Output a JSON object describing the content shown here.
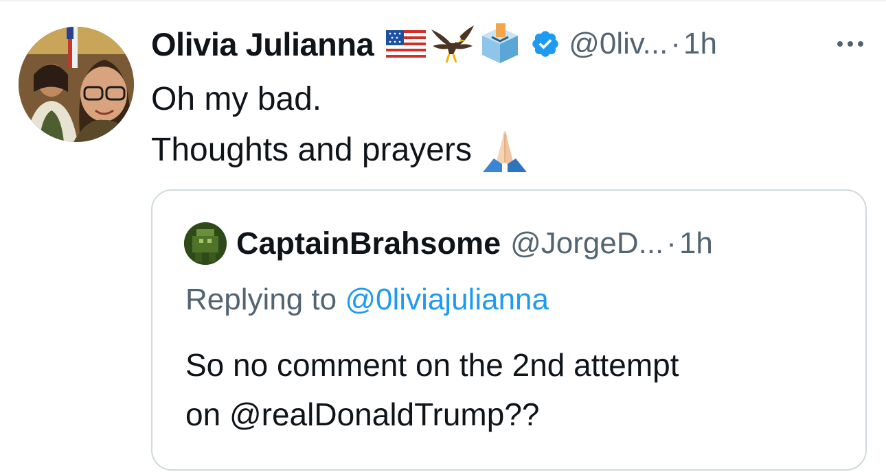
{
  "tweet": {
    "author_name": "Olivia Julianna",
    "author_emojis": [
      "flag-usa-icon",
      "eagle-icon",
      "ballot-box-icon"
    ],
    "handle": "@0liv...",
    "separator": "·",
    "time": "1h",
    "more_icon": "ellipsis-icon",
    "lines": [
      "Oh my bad.",
      "Thoughts and prayers"
    ],
    "trailing_emoji": "folded-hands-icon"
  },
  "quote": {
    "author_name": "CaptainBrahsome",
    "handle": "@JorgeD...",
    "separator": "·",
    "time": "1h",
    "replying_prefix": "Replying to",
    "replying_mention": "@0liviajulianna",
    "lines": [
      "So no comment on the 2nd attempt",
      "on @realDonaldTrump??"
    ]
  },
  "colors": {
    "text_primary": "#0f1419",
    "text_secondary": "#536471",
    "link": "#1d9bf0",
    "border": "#cfd9de",
    "verified": "#1d9bf0"
  }
}
